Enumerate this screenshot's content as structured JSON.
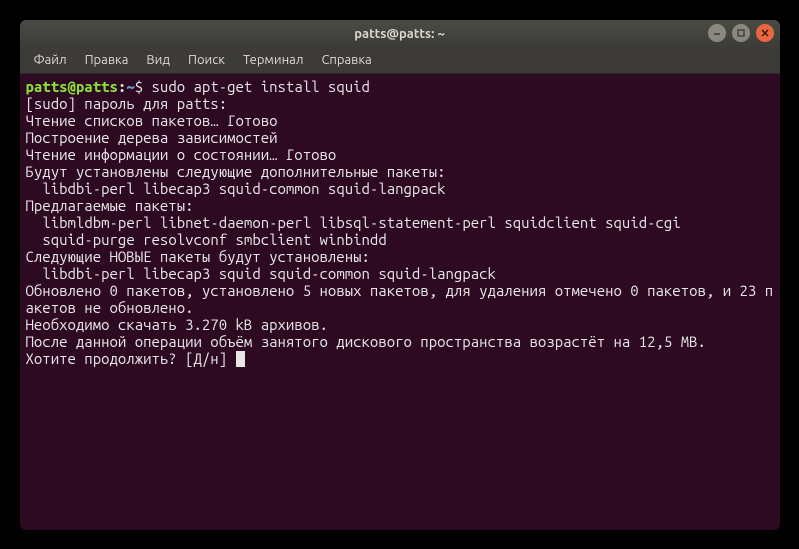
{
  "titlebar": {
    "title": "patts@patts: ~"
  },
  "menubar": {
    "items": [
      "Файл",
      "Правка",
      "Вид",
      "Поиск",
      "Терминал",
      "Справка"
    ]
  },
  "prompt": {
    "userhost": "patts@patts",
    "colon": ":",
    "path": "~",
    "dollar": "$",
    "command": "sudo apt-get install squid"
  },
  "output": {
    "lines": [
      "[sudo] пароль для patts:",
      "Чтение списков пакетов… Готово",
      "Построение дерева зависимостей",
      "Чтение информации о состоянии… Готово",
      "Будут установлены следующие дополнительные пакеты:",
      "  libdbi-perl libecap3 squid-common squid-langpack",
      "Предлагаемые пакеты:",
      "  libmldbm-perl libnet-daemon-perl libsql-statement-perl squidclient squid-cgi",
      "  squid-purge resolvconf smbclient winbindd",
      "Следующие НОВЫЕ пакеты будут установлены:",
      "  libdbi-perl libecap3 squid squid-common squid-langpack",
      "Обновлено 0 пакетов, установлено 5 новых пакетов, для удаления отмечено 0 пакетов, и 23 пакетов не обновлено.",
      "Необходимо скачать 3.270 kB архивов.",
      "После данной операции объём занятого дискового пространства возрастёт на 12,5 MB.",
      "Хотите продолжить? [Д/н] "
    ]
  }
}
